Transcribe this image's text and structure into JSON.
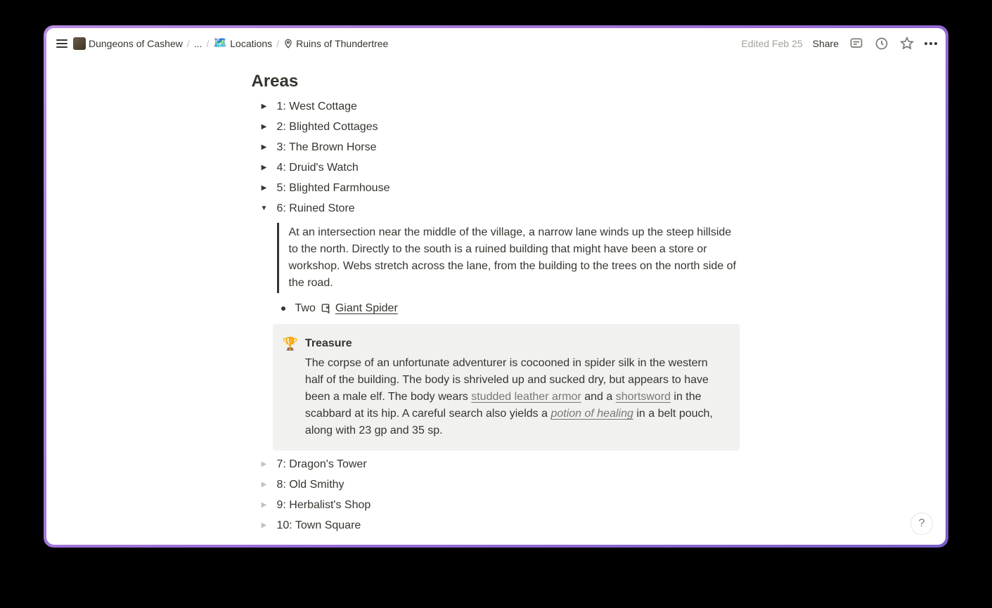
{
  "breadcrumbs": {
    "root_label": "Dungeons of Cashew",
    "ellipsis": "...",
    "locations_emoji": "🗺️",
    "locations_label": "Locations",
    "current_label": "Ruins of Thundertree"
  },
  "topbar": {
    "edited_label": "Edited Feb 25",
    "share_label": "Share"
  },
  "section_title": "Areas",
  "areas": [
    {
      "label": "1: West Cottage",
      "expanded": false,
      "dim": false
    },
    {
      "label": "2: Blighted Cottages",
      "expanded": false,
      "dim": false
    },
    {
      "label": "3: The Brown Horse",
      "expanded": false,
      "dim": false
    },
    {
      "label": "4: Druid's Watch",
      "expanded": false,
      "dim": false
    },
    {
      "label": "5: Blighted Farmhouse",
      "expanded": false,
      "dim": false
    },
    {
      "label": "6: Ruined Store",
      "expanded": true,
      "dim": false
    },
    {
      "label": "7: Dragon's Tower",
      "expanded": false,
      "dim": true
    },
    {
      "label": "8: Old Smithy",
      "expanded": false,
      "dim": true
    },
    {
      "label": "9: Herbalist's Shop",
      "expanded": false,
      "dim": true
    },
    {
      "label": "10: Town Square",
      "expanded": false,
      "dim": true
    }
  ],
  "ruined_store": {
    "quote": "At an intersection near the middle of the village, a narrow lane winds up the steep hillside to the north. Directly to the south is a ruined building that might have been a store or workshop. Webs stretch across the lane, from the building to the trees on the north side of the road.",
    "bullet_prefix": "Two ",
    "bullet_link": "Giant Spider",
    "callout": {
      "emoji": "🏆",
      "title": "Treasure",
      "text_before_armor": "The corpse of an unfortunate adventurer is cocooned in spider silk in the western half of the building. The body is shriveled up and sucked dry, but appears to have been a male elf. The body wears ",
      "link_armor": "studded leather armor",
      "text_between_armor_sword": " and a ",
      "link_sword": "shortsword",
      "text_between_sword_potion": " in the scabbard at its hip. A careful search also yields a ",
      "link_potion": "potion of healing",
      "text_after_potion": " in a belt pouch, along with 23 gp and 35 sp."
    }
  },
  "help_label": "?"
}
